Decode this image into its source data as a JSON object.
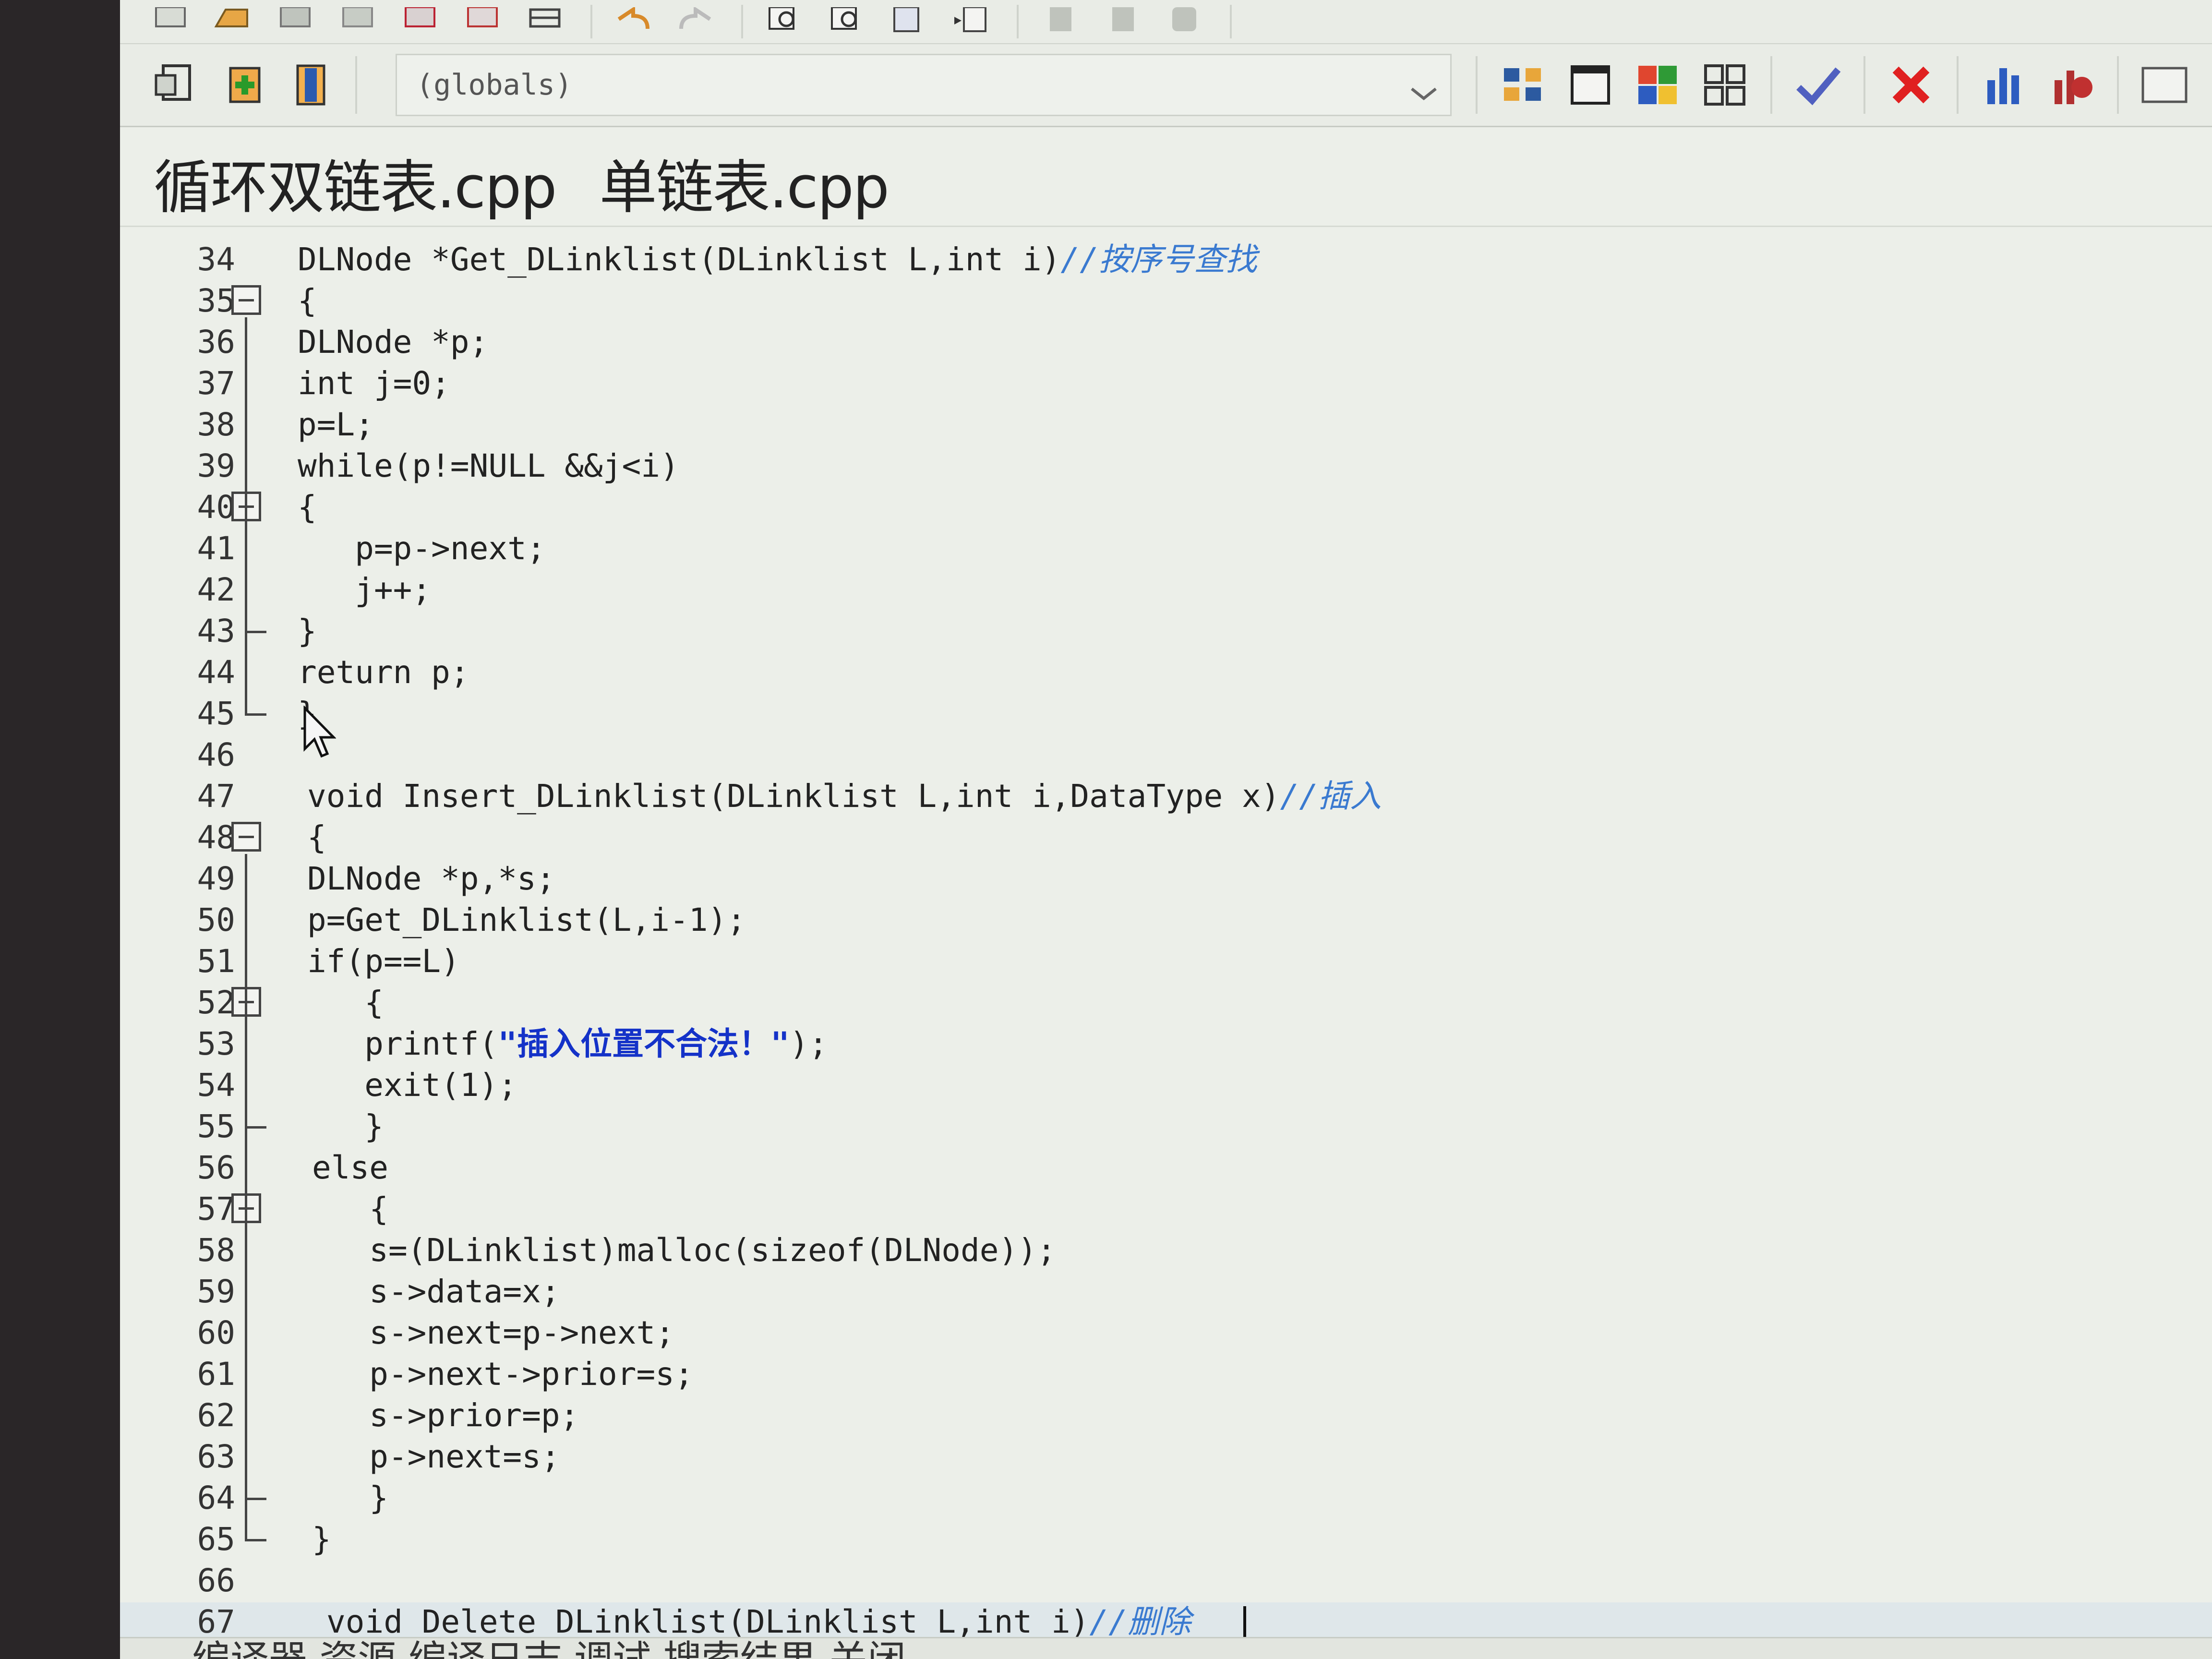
{
  "toolbar": {
    "scope_combo": {
      "value": "(globals)"
    }
  },
  "tabs": [
    {
      "label": "循环双链表.cpp"
    },
    {
      "label": "单链表.cpp"
    }
  ],
  "editor": {
    "lines": [
      {
        "n": "34",
        "text": "DLNode *Get_DLinklist(DLinklist L,int i)",
        "comment": "//按序号查找"
      },
      {
        "n": "35",
        "text": "{"
      },
      {
        "n": "36",
        "text": "DLNode *p;"
      },
      {
        "n": "37",
        "text": "int j=0;"
      },
      {
        "n": "38",
        "text": "p=L;"
      },
      {
        "n": "39",
        "text": "while(p!=NULL &&j<i)"
      },
      {
        "n": "40",
        "text": "{"
      },
      {
        "n": "41",
        "text": "   p=p->next;"
      },
      {
        "n": "42",
        "text": "   j++;"
      },
      {
        "n": "43",
        "text": "}"
      },
      {
        "n": "44",
        "text": "return p;"
      },
      {
        "n": "45",
        "text": "}"
      },
      {
        "n": "46",
        "text": ""
      },
      {
        "n": "47",
        "text": "void Insert_DLinklist(DLinklist L,int i,DataType x)",
        "comment": "//插入"
      },
      {
        "n": "48",
        "text": "{"
      },
      {
        "n": "49",
        "text": "DLNode *p,*s;"
      },
      {
        "n": "50",
        "text": "p=Get_DLinklist(L,i-1);"
      },
      {
        "n": "51",
        "text": "if(p==L)"
      },
      {
        "n": "52",
        "text": "   {"
      },
      {
        "n": "53",
        "text": "   printf(",
        "string": "\"插入位置不合法！\"",
        "after": ");"
      },
      {
        "n": "54",
        "text": "   exit(1);"
      },
      {
        "n": "55",
        "text": "   }"
      },
      {
        "n": "56",
        "text": "else"
      },
      {
        "n": "57",
        "text": "   {"
      },
      {
        "n": "58",
        "text": "   s=(DLinklist)malloc(sizeof(DLNode));"
      },
      {
        "n": "59",
        "text": "   s->data=x;"
      },
      {
        "n": "60",
        "text": "   s->next=p->next;"
      },
      {
        "n": "61",
        "text": "   p->next->prior=s;"
      },
      {
        "n": "62",
        "text": "   s->prior=p;"
      },
      {
        "n": "63",
        "text": "   p->next=s;"
      },
      {
        "n": "64",
        "text": "   }"
      },
      {
        "n": "65",
        "text": "}"
      },
      {
        "n": "66",
        "text": ""
      },
      {
        "n": "67",
        "text": "void Delete_DLinklist(DLinklist L,int i)",
        "comment": "//删除"
      }
    ]
  },
  "status": {
    "text": "编译器 资源 编译日志 调试 搜索结果 关闭"
  },
  "colors": {
    "keyword": "#111111",
    "number": "#b02020",
    "string": "#1432c8",
    "comment": "#3a7ad0",
    "current_line": "#dfe7ea"
  }
}
